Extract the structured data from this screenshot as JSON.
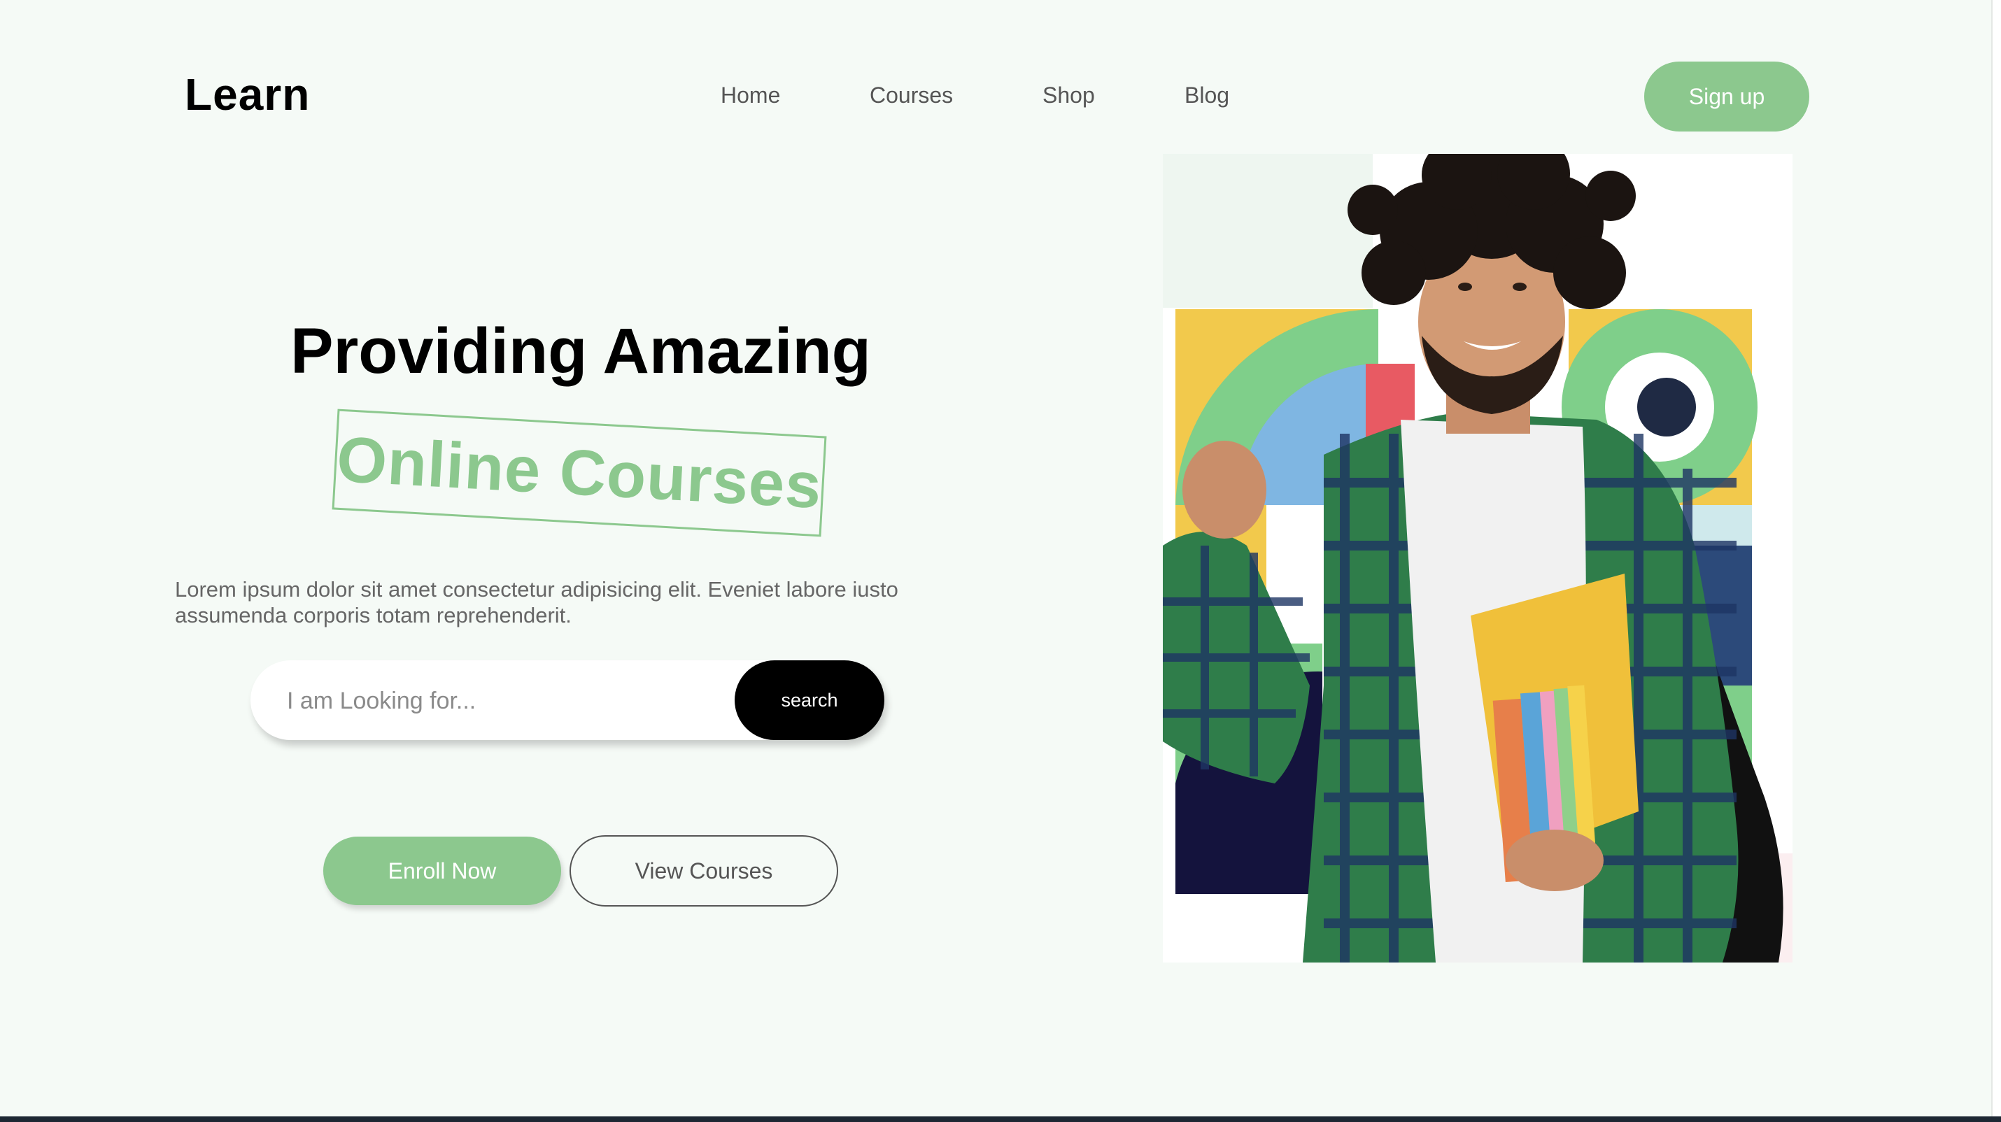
{
  "brand": {
    "logo": "Learn"
  },
  "nav": {
    "items": [
      {
        "label": "Home"
      },
      {
        "label": "Courses"
      },
      {
        "label": "Shop"
      },
      {
        "label": "Blog"
      }
    ],
    "signup_label": "Sign up"
  },
  "hero": {
    "headline": "Providing Amazing",
    "highlight": "Online Courses",
    "lead": "Lorem ipsum dolor sit amet consectetur adipisicing elit. Eveniet labore iusto assumenda corporis totam reprehenderit.",
    "search": {
      "placeholder": "I am Looking for...",
      "value": "",
      "button_label": "search"
    },
    "enroll_label": "Enroll Now",
    "view_courses_label": "View Courses",
    "image_icon": "student-photo-illustration"
  },
  "colors": {
    "accent": "#8cc88e",
    "background": "#f5faf6",
    "text_dark": "#000000",
    "text_muted": "#666666",
    "footer_bar": "#1d2733"
  }
}
